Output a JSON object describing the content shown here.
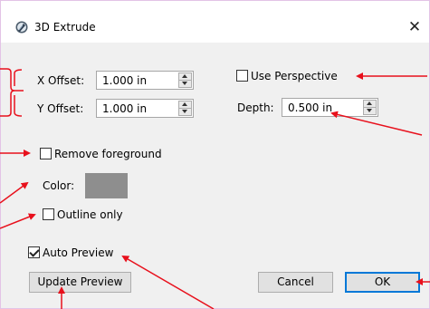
{
  "dialog": {
    "title": "3D Extrude",
    "close_glyph": "✕",
    "icon": "extrude-app-icon"
  },
  "fields": {
    "x_offset_label": "X Offset:",
    "x_offset_value": "1.000 in",
    "y_offset_label": "Y Offset:",
    "y_offset_value": "1.000 in",
    "depth_label": "Depth:",
    "depth_value": "0.500 in"
  },
  "options": {
    "use_perspective_label": "Use Perspective",
    "use_perspective_checked": false,
    "remove_foreground_label": "Remove foreground",
    "remove_foreground_checked": false,
    "color_label": "Color:",
    "color_value": "#8e8e8e",
    "outline_only_label": "Outline only",
    "outline_only_checked": false,
    "auto_preview_label": "Auto Preview",
    "auto_preview_checked": true
  },
  "buttons": {
    "update_preview": "Update Preview",
    "cancel": "Cancel",
    "ok": "OK"
  },
  "colors": {
    "annotation": "#e8101c",
    "default_button_border": "#0078d7",
    "window_border": "#e3c3e6"
  }
}
